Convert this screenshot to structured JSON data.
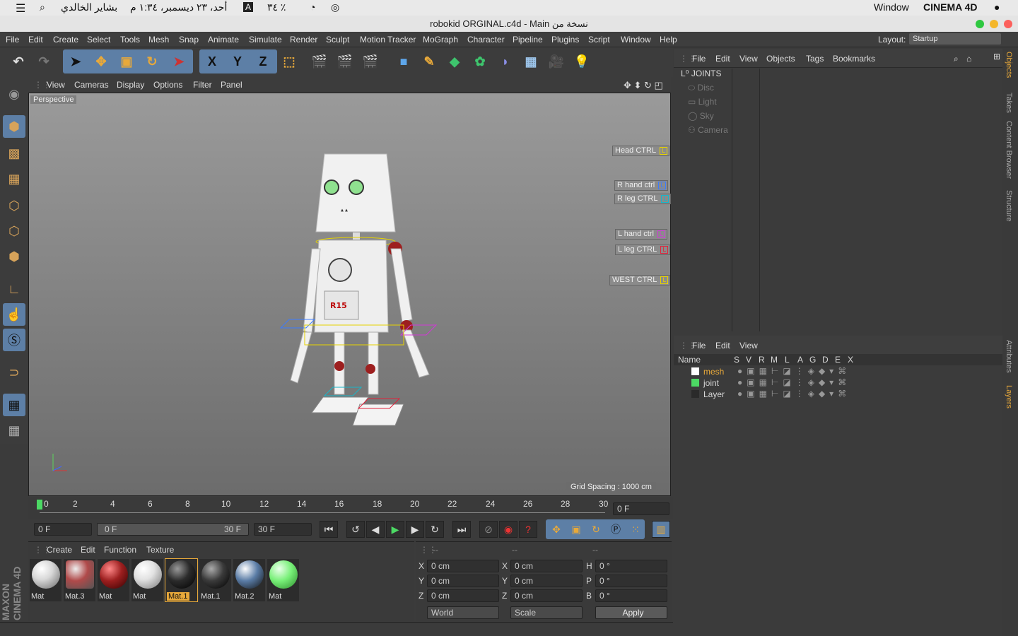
{
  "mac_menu": {
    "app": "CINEMA 4D",
    "window": "Window",
    "clock": "أحد، ٢٣ ديسمبر، ١:٣٤ م",
    "user": "بشاير الخالدي",
    "battery": "٣٤ ٪",
    "input": "A"
  },
  "window_title": "robokid ORGINAL.c4d - Main نسخة من",
  "menu": [
    "File",
    "Edit",
    "Create",
    "Select",
    "Tools",
    "Mesh",
    "Snap",
    "Animate",
    "Simulate",
    "Render",
    "Sculpt",
    "Motion Tracker",
    "MoGraph",
    "Character",
    "Pipeline",
    "Plugins",
    "Script",
    "Window",
    "Help"
  ],
  "layout": {
    "label": "Layout:",
    "value": "Startup"
  },
  "axis": {
    "x": "X",
    "y": "Y",
    "z": "Z"
  },
  "viewport": {
    "menu": [
      "View",
      "Cameras",
      "Display",
      "Options",
      "Filter",
      "Panel"
    ],
    "label": "Perspective",
    "grid_spacing": "Grid Spacing : 1000 cm",
    "controllers": [
      {
        "name": "Head CTRL",
        "color": "#e6d200"
      },
      {
        "name": "R hand ctrl",
        "color": "#3b7bff"
      },
      {
        "name": "R leg CTRL",
        "color": "#19b6c9"
      },
      {
        "name": "L hand ctrl",
        "color": "#d03ad6"
      },
      {
        "name": "L leg CTRL",
        "color": "#e0233b"
      },
      {
        "name": "WEST CTRL",
        "color": "#e6d200"
      }
    ],
    "robot_chest_text": "R15"
  },
  "timeline": {
    "ticks": [
      "0",
      "2",
      "4",
      "6",
      "8",
      "10",
      "12",
      "14",
      "16",
      "18",
      "20",
      "22",
      "24",
      "26",
      "28",
      "30"
    ],
    "current": "0 F",
    "start": "0 F",
    "range_start": "0 F",
    "range_end": "30 F",
    "end": "30 F"
  },
  "materials": {
    "menu": [
      "Create",
      "Edit",
      "Function",
      "Texture"
    ],
    "items": [
      {
        "name": "Mat",
        "color": "#d8d8d8"
      },
      {
        "name": "Mat.3",
        "color": "#b04a4a"
      },
      {
        "name": "Mat",
        "color": "#9c1f1f"
      },
      {
        "name": "Mat",
        "color": "#e2e2e2"
      },
      {
        "name": "Mat.1",
        "color": "#2b2b2b"
      },
      {
        "name": "Mat.1",
        "color": "#3a3a3a"
      },
      {
        "name": "Mat.2",
        "color": "#5a7ca6"
      },
      {
        "name": "Mat",
        "color": "#78f078"
      }
    ]
  },
  "coords": {
    "headers": [
      "--",
      "--",
      "--"
    ],
    "rows": [
      [
        "X",
        "0 cm",
        "X",
        "0 cm",
        "H",
        "0 °"
      ],
      [
        "Y",
        "0 cm",
        "Y",
        "0 cm",
        "P",
        "0 °"
      ],
      [
        "Z",
        "0 cm",
        "Z",
        "0 cm",
        "B",
        "0 °"
      ]
    ],
    "mode1": "World",
    "mode2": "Scale",
    "apply": "Apply"
  },
  "objects": {
    "menu": [
      "File",
      "Edit",
      "View",
      "Objects",
      "Tags",
      "Bookmarks"
    ],
    "items": [
      "JOINTS",
      "Disc",
      "Light",
      "Sky",
      "Camera"
    ]
  },
  "layers": {
    "menu": [
      "File",
      "Edit",
      "View"
    ],
    "columns": [
      "Name",
      "S",
      "V",
      "R",
      "M",
      "L",
      "A",
      "G",
      "D",
      "E",
      "X"
    ],
    "items": [
      {
        "name": "mesh",
        "color": "#ffffff",
        "active": true
      },
      {
        "name": "joint",
        "color": "#4cd964",
        "active": false
      },
      {
        "name": "Layer",
        "color": "#2a2a2a",
        "active": false
      }
    ]
  },
  "side_tabs": [
    "Objects",
    "Takes",
    "Content Browser",
    "Structure",
    "Attributes",
    "Layers"
  ],
  "brand": "MAXON CINEMA 4D"
}
